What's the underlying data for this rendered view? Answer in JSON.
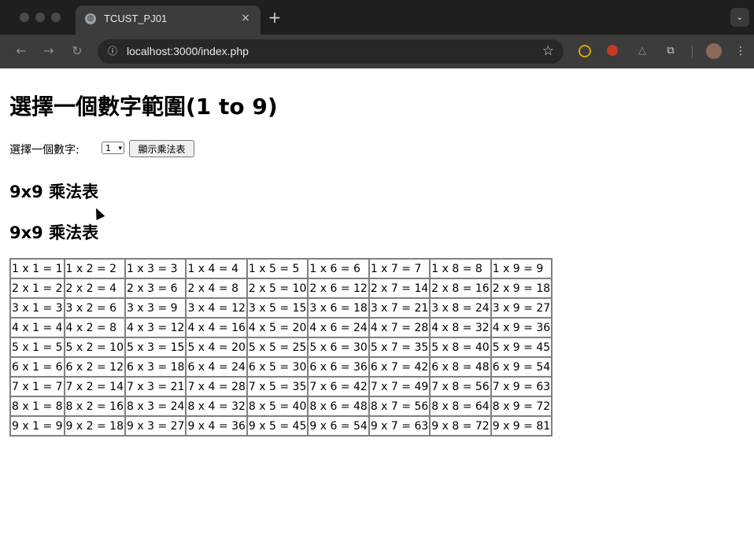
{
  "browser": {
    "tab_title": "TCUST_PJ01",
    "tab_close_icon": "×",
    "new_tab_icon": "+",
    "url": "localhost:3000/index.php"
  },
  "page": {
    "title": "選擇一個數字範圍(1 to 9)",
    "form": {
      "label": "選擇一個數字:",
      "selected": "1",
      "button_label": "顯示乘法表"
    },
    "heading1": "9x9 乘法表",
    "heading2": "9x9 乘法表"
  },
  "table": [
    [
      "1 x 1 = 1",
      "1 x 2 = 2",
      "1 x 3 = 3",
      "1 x 4 = 4",
      "1 x 5 = 5",
      "1 x 6 = 6",
      "1 x 7 = 7",
      "1 x 8 = 8",
      "1 x 9 = 9"
    ],
    [
      "2 x 1 = 2",
      "2 x 2 = 4",
      "2 x 3 = 6",
      "2 x 4 = 8",
      "2 x 5 = 10",
      "2 x 6 = 12",
      "2 x 7 = 14",
      "2 x 8 = 16",
      "2 x 9 = 18"
    ],
    [
      "3 x 1 = 3",
      "3 x 2 = 6",
      "3 x 3 = 9",
      "3 x 4 = 12",
      "3 x 5 = 15",
      "3 x 6 = 18",
      "3 x 7 = 21",
      "3 x 8 = 24",
      "3 x 9 = 27"
    ],
    [
      "4 x 1 = 4",
      "4 x 2 = 8",
      "4 x 3 = 12",
      "4 x 4 = 16",
      "4 x 5 = 20",
      "4 x 6 = 24",
      "4 x 7 = 28",
      "4 x 8 = 32",
      "4 x 9 = 36"
    ],
    [
      "5 x 1 = 5",
      "5 x 2 = 10",
      "5 x 3 = 15",
      "5 x 4 = 20",
      "5 x 5 = 25",
      "5 x 6 = 30",
      "5 x 7 = 35",
      "5 x 8 = 40",
      "5 x 9 = 45"
    ],
    [
      "6 x 1 = 6",
      "6 x 2 = 12",
      "6 x 3 = 18",
      "6 x 4 = 24",
      "6 x 5 = 30",
      "6 x 6 = 36",
      "6 x 7 = 42",
      "6 x 8 = 48",
      "6 x 9 = 54"
    ],
    [
      "7 x 1 = 7",
      "7 x 2 = 14",
      "7 x 3 = 21",
      "7 x 4 = 28",
      "7 x 5 = 35",
      "7 x 6 = 42",
      "7 x 7 = 49",
      "7 x 8 = 56",
      "7 x 9 = 63"
    ],
    [
      "8 x 1 = 8",
      "8 x 2 = 16",
      "8 x 3 = 24",
      "8 x 4 = 32",
      "8 x 5 = 40",
      "8 x 6 = 48",
      "8 x 7 = 56",
      "8 x 8 = 64",
      "8 x 9 = 72"
    ],
    [
      "9 x 1 = 9",
      "9 x 2 = 18",
      "9 x 3 = 27",
      "9 x 4 = 36",
      "9 x 5 = 45",
      "9 x 6 = 54",
      "9 x 7 = 63",
      "9 x 8 = 72",
      "9 x 9 = 81"
    ]
  ]
}
